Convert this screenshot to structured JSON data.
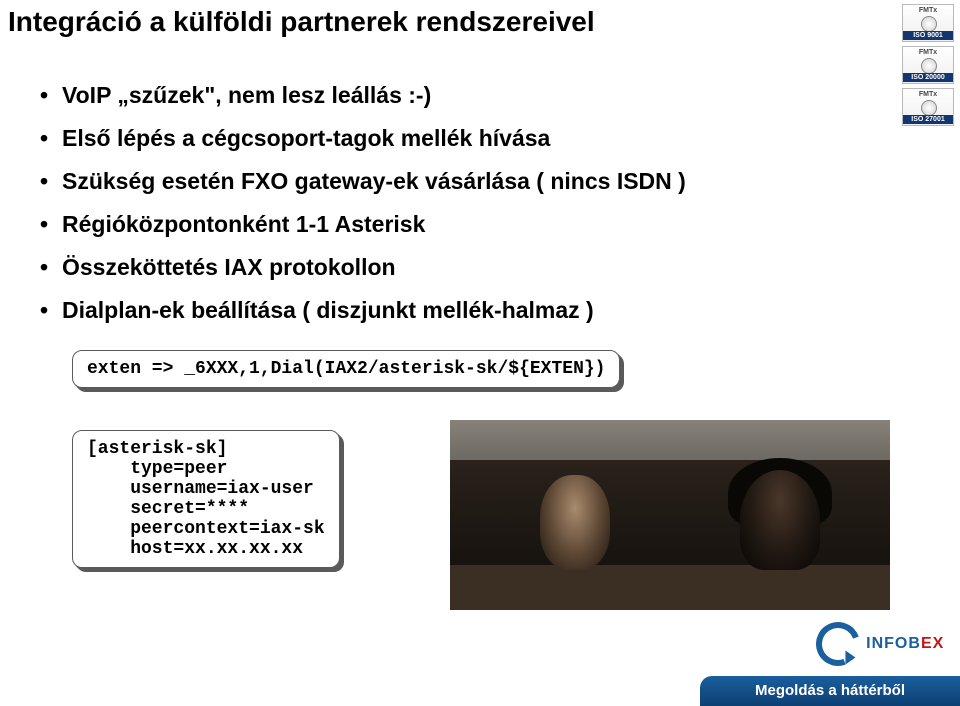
{
  "title": "Integráció a külföldi partnerek rendszereivel",
  "bullets": [
    "VoIP „szűzek\", nem lesz leállás :-)",
    "Első lépés a cégcsoport-tagok mellék hívása",
    "Szükség esetén FXO gateway-ek vásárlása ( nincs ISDN )",
    "Régióközpontonként 1-1 Asterisk",
    "Összeköttetés IAX protokollon",
    "Dialplan-ek beállítása ( diszjunkt mellék-halmaz )"
  ],
  "code1": "exten => _6XXX,1,Dial(IAX2/asterisk-sk/${EXTEN})",
  "code2": "[asterisk-sk]\n    type=peer\n    username=iax-user\n    secret=****\n    peercontext=iax-sk\n    host=xx.xx.xx.xx",
  "certs": {
    "brand": "FMTx",
    "items": [
      "ISO 9001",
      "ISO 20000",
      "ISO 27001"
    ]
  },
  "logo": {
    "part1": "INFOB",
    "part2": "EX"
  },
  "tagline": "Megoldás a háttérből"
}
